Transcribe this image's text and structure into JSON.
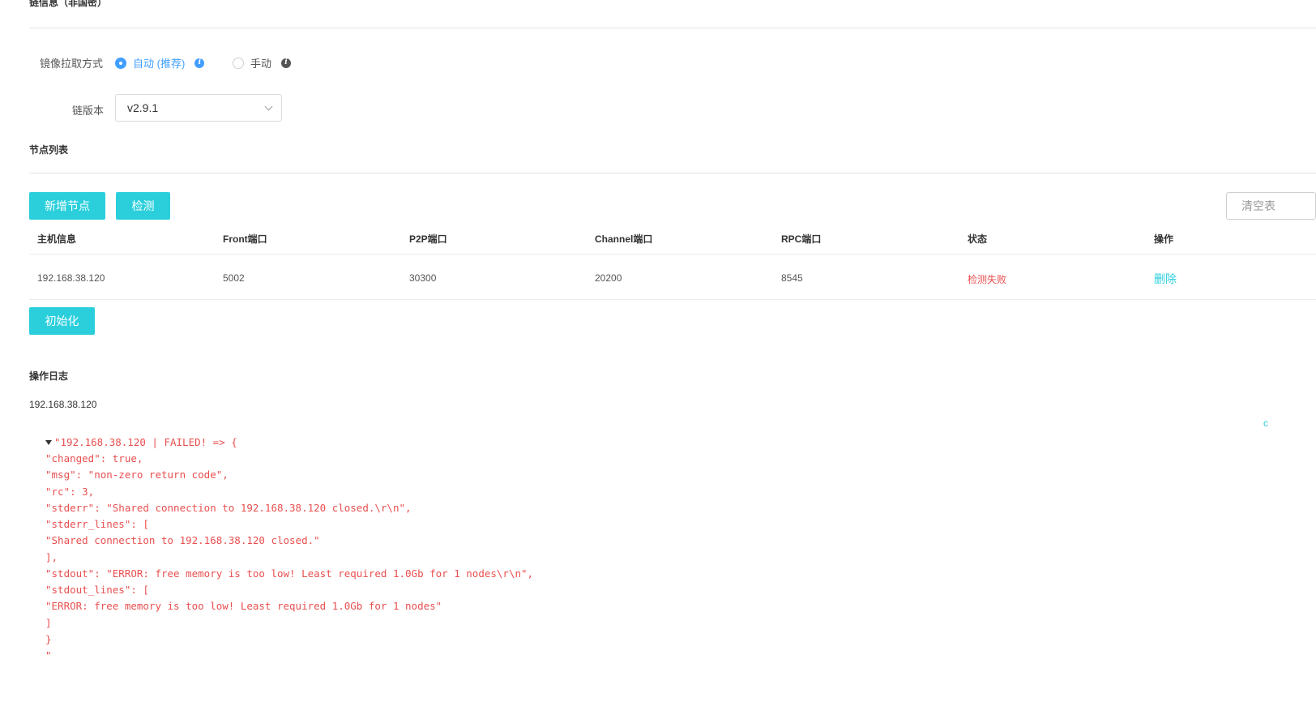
{
  "chain_info": {
    "title": "链信息（非国密）"
  },
  "image_pull": {
    "label": "镜像拉取方式",
    "auto_label": "自动 (推荐)",
    "manual_label": "手动",
    "selected": "auto"
  },
  "chain_version": {
    "label": "链版本",
    "value": "v2.9.1"
  },
  "node_list": {
    "title": "节点列表",
    "add_button": "新增节点",
    "check_button": "检测",
    "clear_button": "清空表",
    "columns": [
      "主机信息",
      "Front端口",
      "P2P端口",
      "Channel端口",
      "RPC端口",
      "状态",
      "操作"
    ],
    "rows": [
      {
        "host": "192.168.38.120",
        "front": "5002",
        "p2p": "30300",
        "channel": "20200",
        "rpc": "8545",
        "status": "检测失败",
        "action": "删除"
      }
    ],
    "init_button": "初始化"
  },
  "op_log": {
    "title": "操作日志",
    "host": "192.168.38.120",
    "edge_label": "c",
    "lines": [
      "\"192.168.38.120 | FAILED! => {",
      "\"changed\": true,",
      "\"msg\": \"non-zero return code\",",
      "\"rc\": 3,",
      "\"stderr\": \"Shared connection to 192.168.38.120 closed.\\r\\n\",",
      "\"stderr_lines\": [",
      "\"Shared connection to 192.168.38.120 closed.\"",
      "],",
      "\"stdout\": \"ERROR: free memory is too low! Least required 1.0Gb for 1 nodes\\r\\n\",",
      "\"stdout_lines\": [",
      "\"ERROR: free memory is too low! Least required 1.0Gb for 1 nodes\"",
      "]",
      "}",
      "\""
    ]
  },
  "colors": {
    "accent": "#2bcfdc",
    "radio_selected": "#409eff",
    "error": "#e94f4f",
    "link": "#2bcfdc"
  }
}
